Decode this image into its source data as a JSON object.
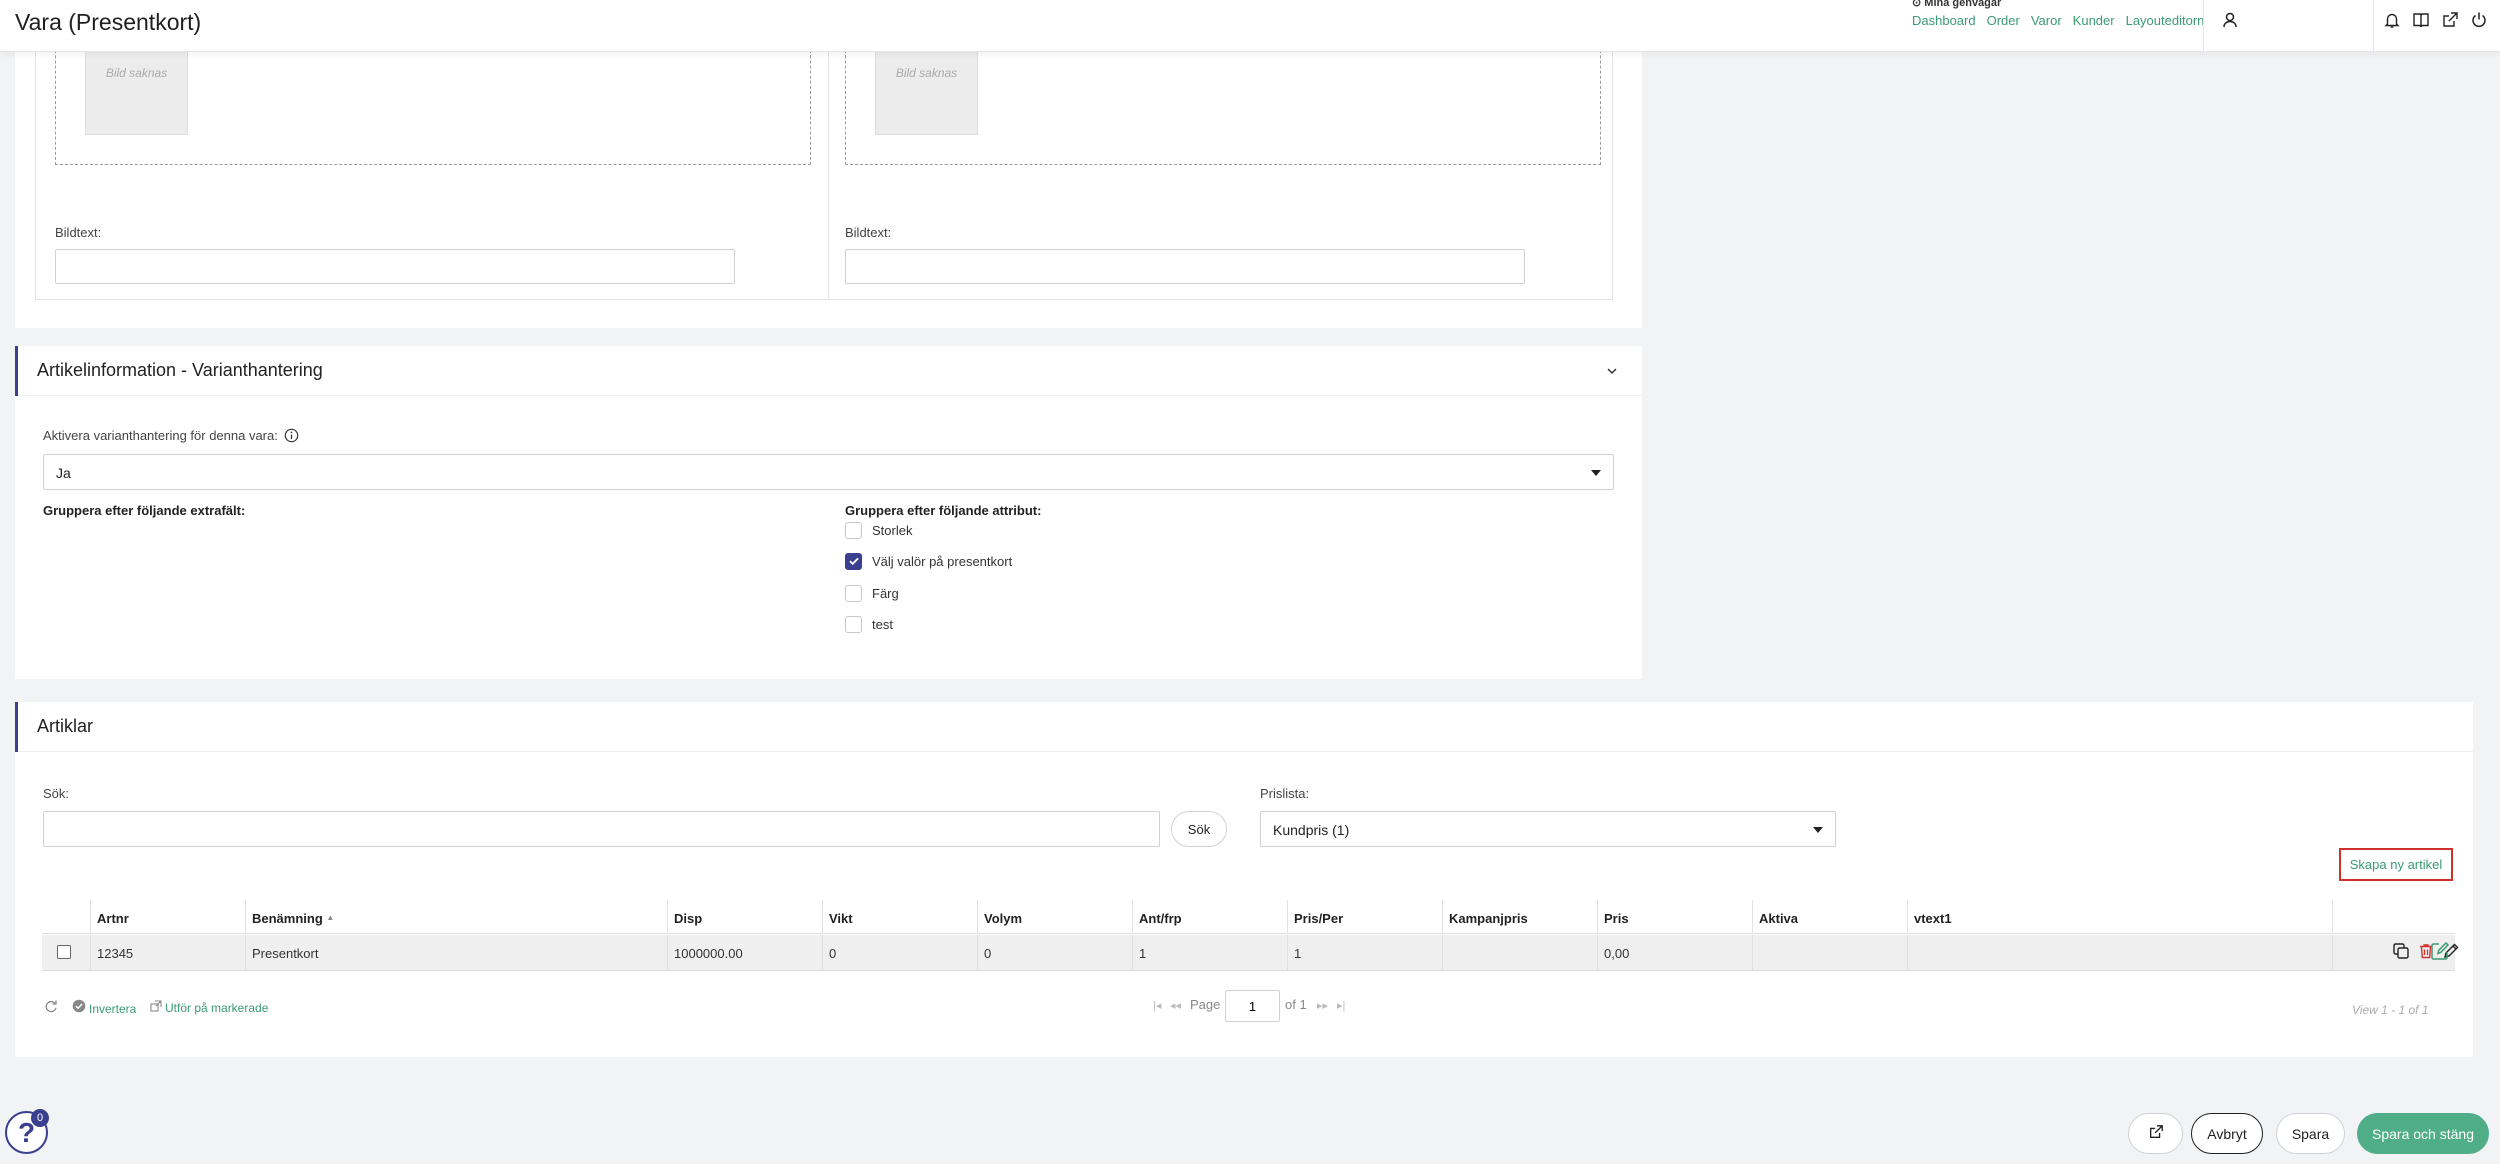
{
  "header": {
    "title": "Vara (Presentkort)",
    "shortcuts_title": "Mina genvägar",
    "shortcuts": [
      "Dashboard",
      "Order",
      "Varor",
      "Kunder",
      "Layouteditorn"
    ]
  },
  "images": {
    "placeholder_text": "Bild saknas",
    "caption_label": "Bildtext:"
  },
  "variant": {
    "title": "Artikelinformation - Varianthantering",
    "activate_label": "Aktivera varianthantering för denna vara:",
    "activate_value": "Ja",
    "group_extra_label": "Gruppera efter följande extrafält:",
    "group_attr_label": "Gruppera efter följande attribut:",
    "attributes": [
      {
        "label": "Storlek",
        "checked": false
      },
      {
        "label": "Välj valör på presentkort",
        "checked": true
      },
      {
        "label": "Färg",
        "checked": false
      },
      {
        "label": "test",
        "checked": false
      }
    ]
  },
  "articles": {
    "title": "Artiklar",
    "search_label": "Sök:",
    "search_button": "Sök",
    "pricelist_label": "Prislista:",
    "pricelist_value": "Kundpris (1)",
    "create_link": "Skapa ny artikel",
    "columns": [
      "Artnr",
      "Benämning",
      "Disp",
      "Vikt",
      "Volym",
      "Ant/frp",
      "Pris/Per",
      "Kampanjpris",
      "Pris",
      "Aktiva",
      "vtext1"
    ],
    "sort_indicator": "▲",
    "rows": [
      [
        "12345",
        "Presentkort",
        "1000000.00",
        "0",
        "0",
        "1",
        "1",
        "",
        "0,00",
        "",
        ""
      ]
    ],
    "invert_label": "Invertera",
    "bulk_label": "Utför på markerade",
    "page_label": "Page",
    "page_value": "1",
    "page_of": "of 1",
    "view_text": "View 1 - 1 of 1"
  },
  "bottom": {
    "cancel": "Avbryt",
    "save": "Spara",
    "save_close": "Spara och stäng",
    "help_badge": "0"
  },
  "colors": {
    "accent": "#3a3f8f",
    "link": "#3c9a74",
    "primary_button": "#4fae87",
    "highlight": "#d0312d"
  }
}
